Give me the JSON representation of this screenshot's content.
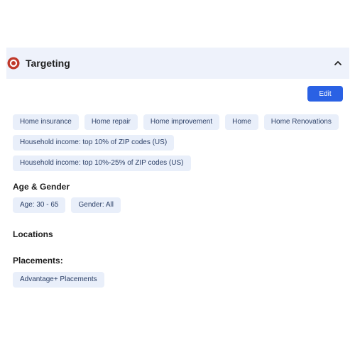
{
  "targeting": {
    "title": "Targeting",
    "edit_label": "Edit",
    "interests": [
      "Home insurance",
      "Home repair",
      "Home improvement",
      "Home",
      "Home Renovations",
      "Household income: top 10% of ZIP codes (US)",
      "Household income: top 10%-25% of ZIP codes (US)"
    ],
    "age_gender": {
      "label": "Age & Gender",
      "age": "Age: 30 - 65",
      "gender": "Gender: All"
    },
    "locations": {
      "label": "Locations"
    },
    "placements": {
      "label": "Placements:",
      "items": [
        "Advantage+ Placements"
      ]
    }
  },
  "colors": {
    "accent": "#2a61e4",
    "header_bg": "#eef2fb",
    "chip_bg": "#e9effa",
    "icon_red": "#c0392b"
  },
  "icons": {
    "section_icon": "target-icon",
    "collapse": "chevron-up-icon"
  }
}
